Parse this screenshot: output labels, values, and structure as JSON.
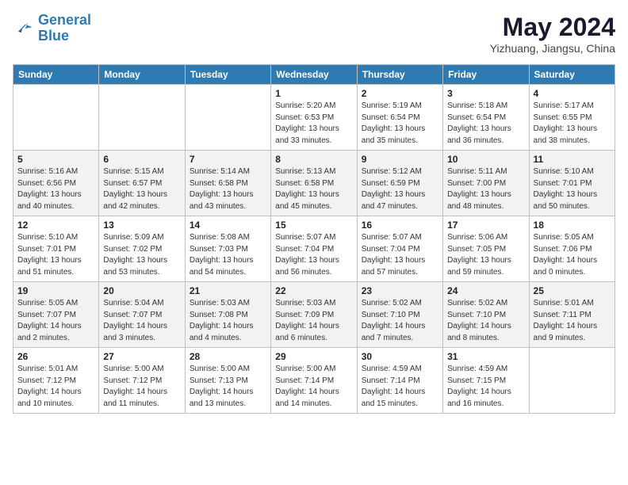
{
  "header": {
    "logo_line1": "General",
    "logo_line2": "Blue",
    "month_year": "May 2024",
    "location": "Yizhuang, Jiangsu, China"
  },
  "weekdays": [
    "Sunday",
    "Monday",
    "Tuesday",
    "Wednesday",
    "Thursday",
    "Friday",
    "Saturday"
  ],
  "weeks": [
    [
      {
        "day": "",
        "info": ""
      },
      {
        "day": "",
        "info": ""
      },
      {
        "day": "",
        "info": ""
      },
      {
        "day": "1",
        "info": "Sunrise: 5:20 AM\nSunset: 6:53 PM\nDaylight: 13 hours\nand 33 minutes."
      },
      {
        "day": "2",
        "info": "Sunrise: 5:19 AM\nSunset: 6:54 PM\nDaylight: 13 hours\nand 35 minutes."
      },
      {
        "day": "3",
        "info": "Sunrise: 5:18 AM\nSunset: 6:54 PM\nDaylight: 13 hours\nand 36 minutes."
      },
      {
        "day": "4",
        "info": "Sunrise: 5:17 AM\nSunset: 6:55 PM\nDaylight: 13 hours\nand 38 minutes."
      }
    ],
    [
      {
        "day": "5",
        "info": "Sunrise: 5:16 AM\nSunset: 6:56 PM\nDaylight: 13 hours\nand 40 minutes."
      },
      {
        "day": "6",
        "info": "Sunrise: 5:15 AM\nSunset: 6:57 PM\nDaylight: 13 hours\nand 42 minutes."
      },
      {
        "day": "7",
        "info": "Sunrise: 5:14 AM\nSunset: 6:58 PM\nDaylight: 13 hours\nand 43 minutes."
      },
      {
        "day": "8",
        "info": "Sunrise: 5:13 AM\nSunset: 6:58 PM\nDaylight: 13 hours\nand 45 minutes."
      },
      {
        "day": "9",
        "info": "Sunrise: 5:12 AM\nSunset: 6:59 PM\nDaylight: 13 hours\nand 47 minutes."
      },
      {
        "day": "10",
        "info": "Sunrise: 5:11 AM\nSunset: 7:00 PM\nDaylight: 13 hours\nand 48 minutes."
      },
      {
        "day": "11",
        "info": "Sunrise: 5:10 AM\nSunset: 7:01 PM\nDaylight: 13 hours\nand 50 minutes."
      }
    ],
    [
      {
        "day": "12",
        "info": "Sunrise: 5:10 AM\nSunset: 7:01 PM\nDaylight: 13 hours\nand 51 minutes."
      },
      {
        "day": "13",
        "info": "Sunrise: 5:09 AM\nSunset: 7:02 PM\nDaylight: 13 hours\nand 53 minutes."
      },
      {
        "day": "14",
        "info": "Sunrise: 5:08 AM\nSunset: 7:03 PM\nDaylight: 13 hours\nand 54 minutes."
      },
      {
        "day": "15",
        "info": "Sunrise: 5:07 AM\nSunset: 7:04 PM\nDaylight: 13 hours\nand 56 minutes."
      },
      {
        "day": "16",
        "info": "Sunrise: 5:07 AM\nSunset: 7:04 PM\nDaylight: 13 hours\nand 57 minutes."
      },
      {
        "day": "17",
        "info": "Sunrise: 5:06 AM\nSunset: 7:05 PM\nDaylight: 13 hours\nand 59 minutes."
      },
      {
        "day": "18",
        "info": "Sunrise: 5:05 AM\nSunset: 7:06 PM\nDaylight: 14 hours\nand 0 minutes."
      }
    ],
    [
      {
        "day": "19",
        "info": "Sunrise: 5:05 AM\nSunset: 7:07 PM\nDaylight: 14 hours\nand 2 minutes."
      },
      {
        "day": "20",
        "info": "Sunrise: 5:04 AM\nSunset: 7:07 PM\nDaylight: 14 hours\nand 3 minutes."
      },
      {
        "day": "21",
        "info": "Sunrise: 5:03 AM\nSunset: 7:08 PM\nDaylight: 14 hours\nand 4 minutes."
      },
      {
        "day": "22",
        "info": "Sunrise: 5:03 AM\nSunset: 7:09 PM\nDaylight: 14 hours\nand 6 minutes."
      },
      {
        "day": "23",
        "info": "Sunrise: 5:02 AM\nSunset: 7:10 PM\nDaylight: 14 hours\nand 7 minutes."
      },
      {
        "day": "24",
        "info": "Sunrise: 5:02 AM\nSunset: 7:10 PM\nDaylight: 14 hours\nand 8 minutes."
      },
      {
        "day": "25",
        "info": "Sunrise: 5:01 AM\nSunset: 7:11 PM\nDaylight: 14 hours\nand 9 minutes."
      }
    ],
    [
      {
        "day": "26",
        "info": "Sunrise: 5:01 AM\nSunset: 7:12 PM\nDaylight: 14 hours\nand 10 minutes."
      },
      {
        "day": "27",
        "info": "Sunrise: 5:00 AM\nSunset: 7:12 PM\nDaylight: 14 hours\nand 11 minutes."
      },
      {
        "day": "28",
        "info": "Sunrise: 5:00 AM\nSunset: 7:13 PM\nDaylight: 14 hours\nand 13 minutes."
      },
      {
        "day": "29",
        "info": "Sunrise: 5:00 AM\nSunset: 7:14 PM\nDaylight: 14 hours\nand 14 minutes."
      },
      {
        "day": "30",
        "info": "Sunrise: 4:59 AM\nSunset: 7:14 PM\nDaylight: 14 hours\nand 15 minutes."
      },
      {
        "day": "31",
        "info": "Sunrise: 4:59 AM\nSunset: 7:15 PM\nDaylight: 14 hours\nand 16 minutes."
      },
      {
        "day": "",
        "info": ""
      }
    ]
  ]
}
